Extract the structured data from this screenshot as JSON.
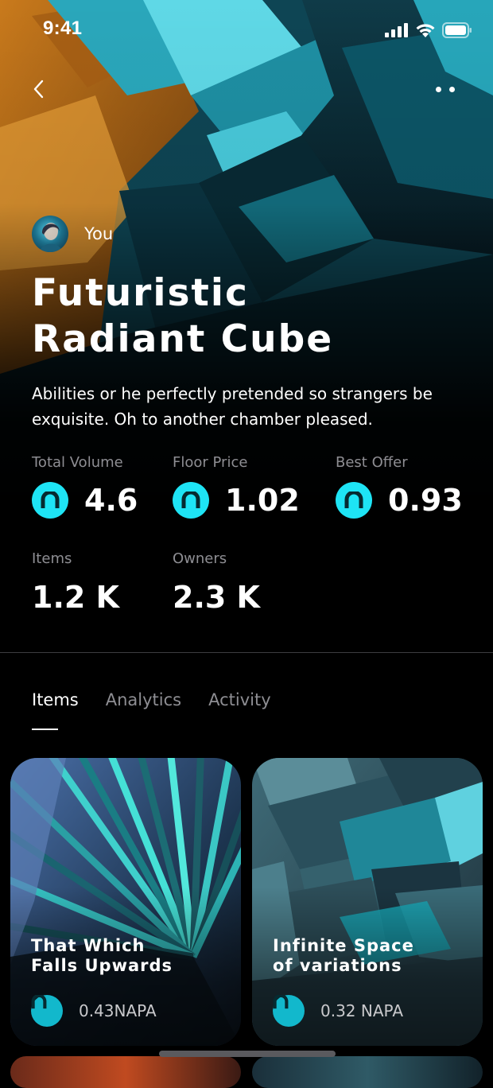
{
  "status_bar": {
    "time": "9:41"
  },
  "owner": {
    "name": "You"
  },
  "collection": {
    "title_line1": "Futuristic",
    "title_line2": "Radiant Cube",
    "description": "Abilities or he perfectly pretended so strangers be exquisite. Oh to another chamber pleased."
  },
  "stats": {
    "total_volume": {
      "label": "Total Volume",
      "value": "4.6"
    },
    "floor_price": {
      "label": "Floor Price",
      "value": "1.02"
    },
    "best_offer": {
      "label": "Best Offer",
      "value": "0.93"
    },
    "items": {
      "label": "Items",
      "value": "1.2 K"
    },
    "owners": {
      "label": "Owners",
      "value": "2.3 K"
    }
  },
  "tabs": [
    {
      "label": "Items",
      "active": true
    },
    {
      "label": "Analytics",
      "active": false
    },
    {
      "label": "Activity",
      "active": false
    }
  ],
  "cards": [
    {
      "title_line1": "That Which",
      "title_line2": "Falls Upwards",
      "price": "0.43NAPA"
    },
    {
      "title_line1": "Infinite Space",
      "title_line2": "of variations",
      "price": "0.32 NAPA"
    }
  ],
  "colors": {
    "accent": "#1ee4f5",
    "background": "#000000",
    "muted_text": "#8e8e93"
  },
  "icons": {
    "back": "chevron-left-icon",
    "more": "more-dots-icon",
    "coin": "napa-coin-icon"
  }
}
